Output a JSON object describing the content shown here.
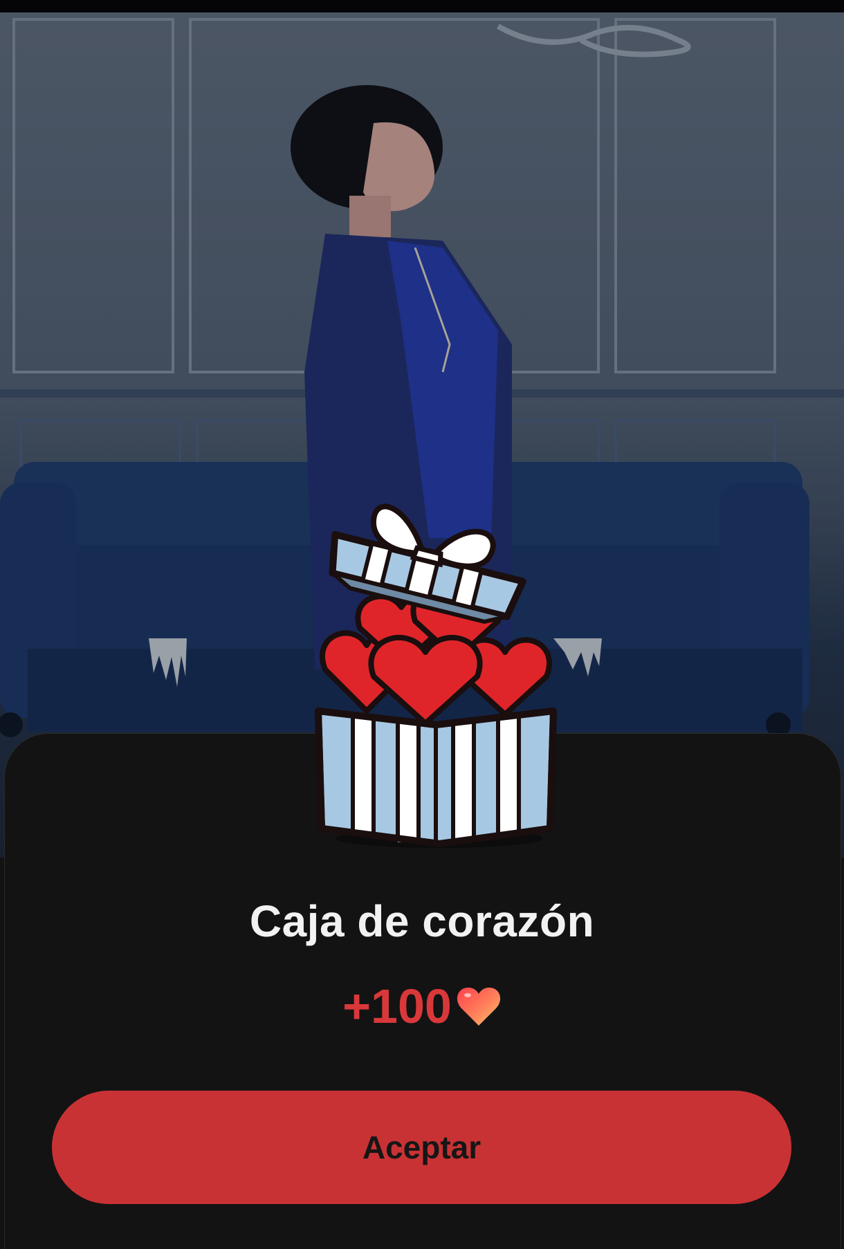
{
  "modal": {
    "title": "Caja de corazón",
    "reward_amount": "+100",
    "reward_icon": "heart-icon",
    "accept_label": "Aceptar"
  },
  "colors": {
    "accent": "#c93234",
    "reward_text": "#d9383a",
    "sheet_background": "#131313",
    "title_text": "#f2f2f2"
  },
  "background": {
    "description_icon": "photo-background",
    "gift_icon": "gift-box-with-hearts-icon"
  }
}
